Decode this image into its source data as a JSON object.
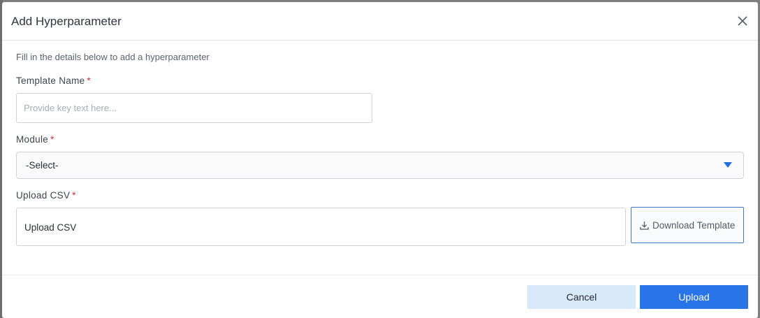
{
  "dialog": {
    "title": "Add Hyperparameter",
    "subtitle": "Fill in the details below to add a hyperparameter"
  },
  "fields": {
    "template_name": {
      "label": "Template Name",
      "required_mark": "*",
      "value": "",
      "placeholder": "Provide key text here..."
    },
    "module": {
      "label": "Module",
      "required_mark": "*",
      "selected": "-Select-"
    },
    "upload_csv": {
      "label": "Upload CSV",
      "required_mark": "*",
      "box_text": "Upload CSV"
    }
  },
  "actions": {
    "download_template": "Download Template",
    "cancel": "Cancel",
    "upload": "Upload"
  },
  "icons": {
    "close": "close-icon",
    "download": "download-icon",
    "caret": "caret-down-icon"
  },
  "colors": {
    "primary": "#2874e8",
    "cancel_bg": "#d8eafa",
    "required": "#d7303a",
    "caret": "#1f6fe0"
  }
}
